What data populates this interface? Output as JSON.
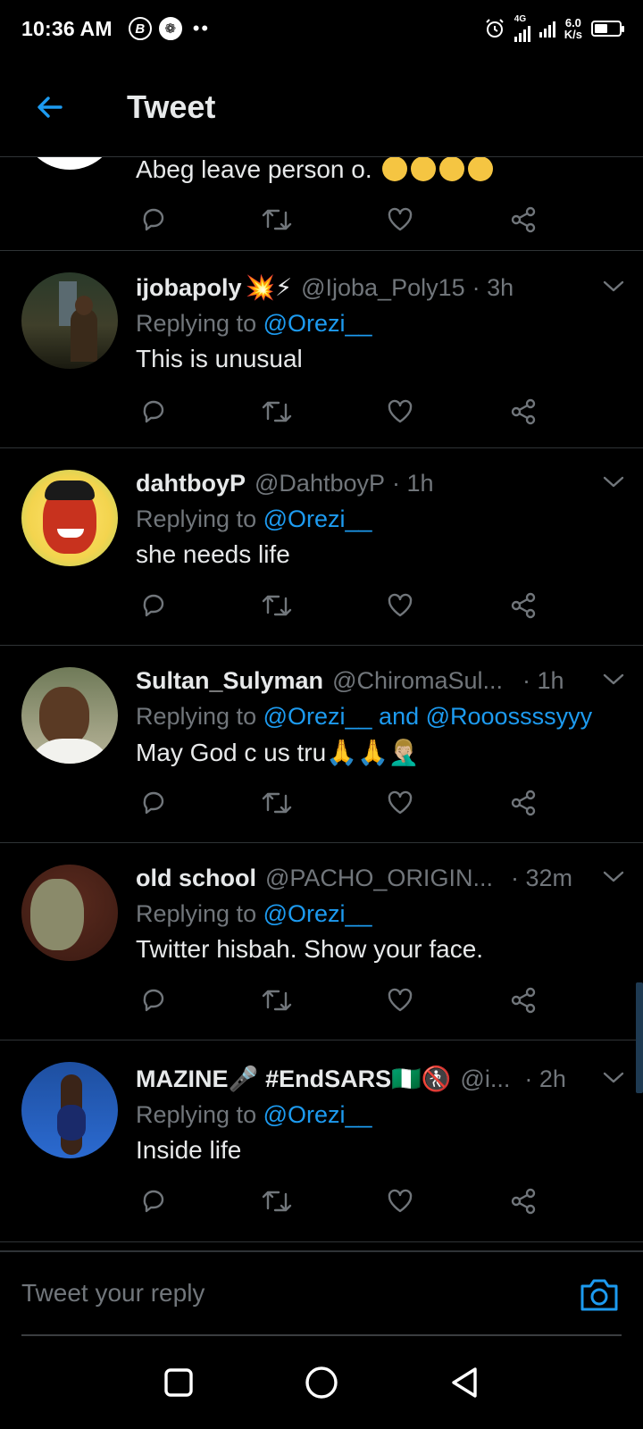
{
  "status": {
    "time": "10:36 AM",
    "network": "4G",
    "speed_top": "6.0",
    "speed_bottom": "K/s",
    "battery_level": 0.55
  },
  "header": {
    "title": "Tweet"
  },
  "partial_tweet": {
    "text": "Abeg leave person o.",
    "emoji": "face-with-tears-of-joy x4"
  },
  "tweets": [
    {
      "name": "ijobapoly",
      "name_emoji": "💥⚡",
      "handle": "@Ijoba_Poly15",
      "time": "· 3h",
      "replying_label": "Replying to",
      "mentions": "@Orezi__",
      "text": "This is unusual"
    },
    {
      "name": "dahtboyP",
      "name_emoji": "",
      "handle": "@DahtboyP",
      "time": "· 1h",
      "replying_label": "Replying to",
      "mentions": "@Orezi__",
      "text": "she needs life"
    },
    {
      "name": "Sultan_Sulyman",
      "name_emoji": "",
      "handle": "@ChiromaSul...",
      "time": "· 1h",
      "replying_label": "Replying to",
      "mentions": "@Orezi__ and @Rooossssyyy",
      "text": "May God c us tru",
      "text_emoji": "🙏🙏🤦🏼‍♂️"
    },
    {
      "name": "old school",
      "name_emoji": "",
      "handle": "@PACHO_ORIGIN...",
      "time": "· 32m",
      "replying_label": "Replying to",
      "mentions": "@Orezi__",
      "text": "Twitter hisbah. Show your face."
    },
    {
      "name": "MAZINE",
      "name_emoji": "🎤",
      "name_tag": "#EndSARS",
      "name_tag_emoji": "🇳🇬🚷",
      "handle": "@i...",
      "time": "· 2h",
      "replying_label": "Replying to",
      "mentions": "@Orezi__",
      "text": "Inside life"
    }
  ],
  "reply_bar": {
    "placeholder": "Tweet your reply"
  },
  "colors": {
    "accent": "#1d9bf0",
    "background": "#000000",
    "divider": "#2f3336",
    "muted": "#71767b"
  }
}
